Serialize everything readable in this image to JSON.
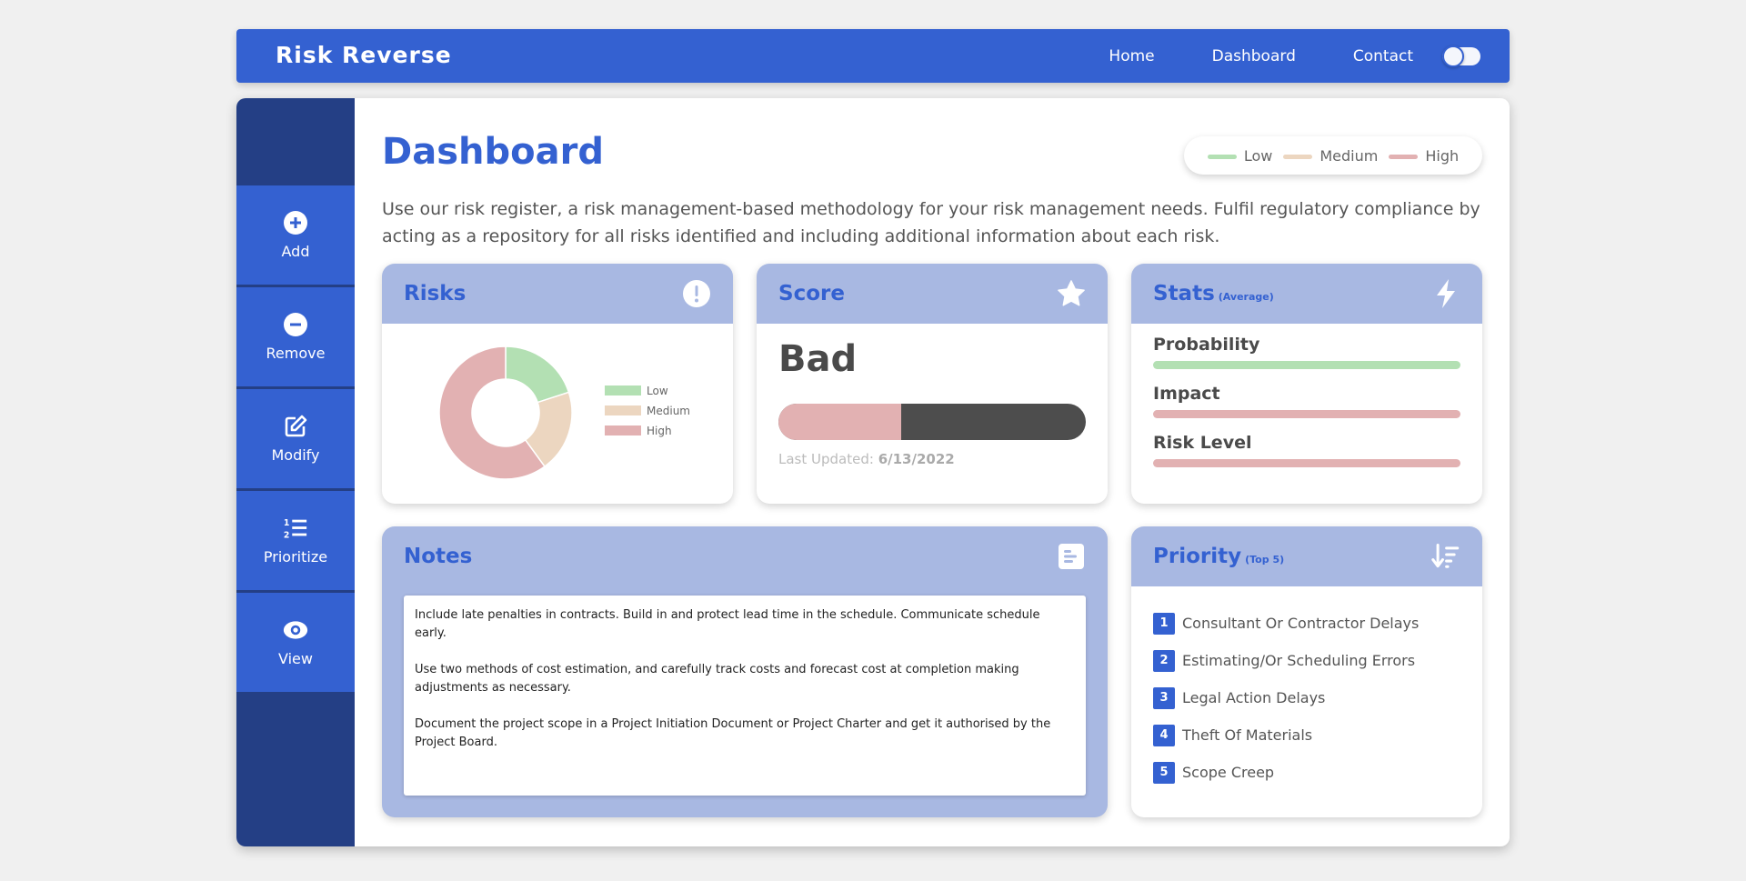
{
  "app": {
    "brand": "Risk Reverse"
  },
  "nav": {
    "items": [
      {
        "label": "Home"
      },
      {
        "label": "Dashboard"
      },
      {
        "label": "Contact"
      }
    ]
  },
  "sidebar": {
    "items": [
      {
        "label": "Add",
        "icon": "plus-circle-icon"
      },
      {
        "label": "Remove",
        "icon": "minus-circle-icon"
      },
      {
        "label": "Modify",
        "icon": "edit-icon"
      },
      {
        "label": "Prioritize",
        "icon": "list-ordered-icon"
      },
      {
        "label": "View",
        "icon": "eye-icon"
      }
    ]
  },
  "page": {
    "title": "Dashboard",
    "description": "Use our risk register, a risk management-based methodology for your risk management needs. Fulfil regulatory compliance by acting as a repository for all risks identified and including additional information about each risk."
  },
  "legend": [
    {
      "label": "Low",
      "color": "#b3e0b3"
    },
    {
      "label": "Medium",
      "color": "#ecd6c0"
    },
    {
      "label": "High",
      "color": "#e2b1b2"
    }
  ],
  "risks": {
    "title": "Risks",
    "icon": "alert-icon"
  },
  "chart_data": {
    "type": "pie",
    "categories": [
      "Low",
      "Medium",
      "High"
    ],
    "values": [
      1,
      1,
      3
    ],
    "colors": [
      "#b3e0b3",
      "#ecd6c0",
      "#e2b1b2"
    ],
    "legend_position": "right"
  },
  "score": {
    "title": "Score",
    "icon": "star-icon",
    "value": "Bad",
    "fill_fraction": 0.4,
    "updated_label": "Last Updated:",
    "updated_date": "6/13/2022"
  },
  "stats": {
    "title": "Stats",
    "subtitle": "(Average)",
    "icon": "lightning-icon",
    "items": [
      {
        "label": "Probability",
        "color": "#b3e0b3"
      },
      {
        "label": "Impact",
        "color": "#e2b1b2"
      },
      {
        "label": "Risk Level",
        "color": "#e2b1b2"
      }
    ]
  },
  "notes": {
    "title": "Notes",
    "icon": "notes-icon",
    "paragraphs": [
      "Include late penalties in contracts. Build in and protect lead time in the schedule. Communicate schedule early.",
      "Use two methods of cost estimation, and carefully track costs and forecast cost at completion making adjustments as necessary.",
      "Document the project scope in a Project Initiation Document or Project Charter and get it authorised by the Project Board."
    ]
  },
  "priority": {
    "title": "Priority",
    "subtitle": "(Top 5)",
    "icon": "sort-desc-icon",
    "items": [
      {
        "num": "1",
        "label": "Consultant Or Contractor Delays"
      },
      {
        "num": "2",
        "label": "Estimating/Or Scheduling Errors"
      },
      {
        "num": "3",
        "label": "Legal Action Delays"
      },
      {
        "num": "4",
        "label": "Theft Of Materials"
      },
      {
        "num": "5",
        "label": "Scope Creep"
      }
    ]
  }
}
